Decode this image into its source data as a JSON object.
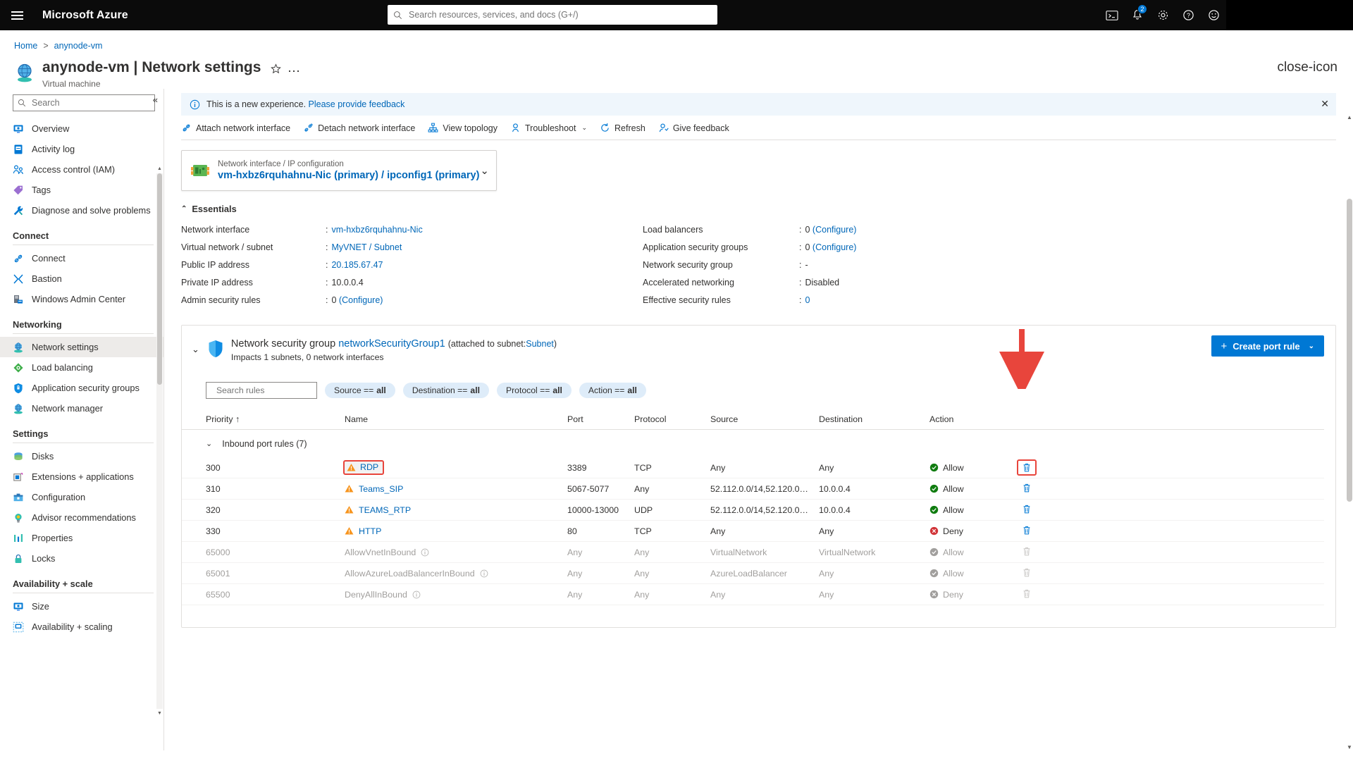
{
  "topbar": {
    "brand": "Microsoft Azure",
    "search_placeholder": "Search resources, services, and docs (G+/)",
    "notification_count": "2",
    "icons": [
      "cloud-shell-icon",
      "notifications-bell-icon",
      "settings-gear-icon",
      "help-question-icon",
      "feedback-smiley-icon"
    ]
  },
  "breadcrumb": {
    "home": "Home",
    "separator": ">",
    "current": "anynode-vm"
  },
  "header": {
    "title": "anynode-vm | Network settings",
    "subtitle": "Virtual machine",
    "favorite_icon": "star-icon",
    "more_icon": "ellipsis-icon",
    "close_icon": "close-icon"
  },
  "sidebar": {
    "search_placeholder": "Search",
    "collapse_label": "«",
    "items": [
      {
        "label": "Overview",
        "icon": "overview-icon",
        "type": "item",
        "selected": false
      },
      {
        "label": "Activity log",
        "icon": "activity-log-icon",
        "type": "item",
        "selected": false
      },
      {
        "label": "Access control (IAM)",
        "icon": "access-control-icon",
        "type": "item",
        "selected": false
      },
      {
        "label": "Tags",
        "icon": "tags-icon",
        "type": "item",
        "selected": false
      },
      {
        "label": "Diagnose and solve problems",
        "icon": "diagnose-icon",
        "type": "item",
        "selected": false
      },
      {
        "label": "Connect",
        "type": "group"
      },
      {
        "label": "Connect",
        "icon": "connect-icon",
        "type": "item",
        "selected": false
      },
      {
        "label": "Bastion",
        "icon": "bastion-icon",
        "type": "item",
        "selected": false
      },
      {
        "label": "Windows Admin Center",
        "icon": "windows-admin-center-icon",
        "type": "item",
        "selected": false
      },
      {
        "label": "Networking",
        "type": "group"
      },
      {
        "label": "Network settings",
        "icon": "network-settings-icon",
        "type": "item",
        "selected": true
      },
      {
        "label": "Load balancing",
        "icon": "load-balancing-icon",
        "type": "item",
        "selected": false
      },
      {
        "label": "Application security groups",
        "icon": "app-security-groups-icon",
        "type": "item",
        "selected": false
      },
      {
        "label": "Network manager",
        "icon": "network-manager-icon",
        "type": "item",
        "selected": false
      },
      {
        "label": "Settings",
        "type": "group"
      },
      {
        "label": "Disks",
        "icon": "disks-icon",
        "type": "item",
        "selected": false
      },
      {
        "label": "Extensions + applications",
        "icon": "extensions-icon",
        "type": "item",
        "selected": false
      },
      {
        "label": "Configuration",
        "icon": "configuration-icon",
        "type": "item",
        "selected": false
      },
      {
        "label": "Advisor recommendations",
        "icon": "advisor-icon",
        "type": "item",
        "selected": false
      },
      {
        "label": "Properties",
        "icon": "properties-icon",
        "type": "item",
        "selected": false
      },
      {
        "label": "Locks",
        "icon": "locks-icon",
        "type": "item",
        "selected": false
      },
      {
        "label": "Availability + scale",
        "type": "group"
      },
      {
        "label": "Size",
        "icon": "size-icon",
        "type": "item",
        "selected": false
      },
      {
        "label": "Availability + scaling",
        "icon": "availability-scaling-icon",
        "type": "item",
        "selected": false
      }
    ]
  },
  "notice": {
    "text": "This is a new experience.",
    "link": "Please provide feedback",
    "icon": "info-circle-icon",
    "dismiss": "✕"
  },
  "toolbar": [
    {
      "label": "Attach network interface",
      "icon": "attach-nic-icon",
      "chevron": false
    },
    {
      "label": "Detach network interface",
      "icon": "detach-nic-icon",
      "chevron": false
    },
    {
      "label": "View topology",
      "icon": "topology-icon",
      "chevron": false
    },
    {
      "label": "Troubleshoot",
      "icon": "troubleshoot-icon",
      "chevron": true
    },
    {
      "label": "Refresh",
      "icon": "refresh-icon",
      "chevron": false
    },
    {
      "label": "Give feedback",
      "icon": "give-feedback-icon",
      "chevron": false
    }
  ],
  "nic_card": {
    "label": "Network interface / IP configuration",
    "value": "vm-hxbz6rquhahnu-Nic (primary) / ipconfig1 (primary)",
    "icon": "nic-icon",
    "chevron": "⌄"
  },
  "essentials": {
    "title": "Essentials",
    "chevron": "⌃",
    "left": [
      {
        "key": "Network interface",
        "value": "vm-hxbz6rquhahnu-Nic",
        "link": true
      },
      {
        "key": "Virtual network / subnet",
        "value": "MyVNET / Subnet",
        "link": true
      },
      {
        "key": "Public IP address",
        "value": "20.185.67.47",
        "link": true
      },
      {
        "key": "Private IP address",
        "value": "10.0.0.4",
        "link": false
      },
      {
        "key": "Admin security rules",
        "value": "0",
        "suffix": "(Configure)",
        "link": false
      }
    ],
    "right": [
      {
        "key": "Load balancers",
        "value": "0",
        "suffix": "(Configure)",
        "link": false
      },
      {
        "key": "Application security groups",
        "value": "0",
        "suffix": "(Configure)",
        "link": false
      },
      {
        "key": "Network security group",
        "value": "-",
        "link": false
      },
      {
        "key": "Accelerated networking",
        "value": "Disabled",
        "link": false
      },
      {
        "key": "Effective security rules",
        "value": "0",
        "link": true
      }
    ]
  },
  "nsg": {
    "chevron": "⌄",
    "shield_icon": "shield-icon",
    "title_prefix": "Network security group",
    "name": "networkSecurityGroup1",
    "attached_text": "(attached to subnet:",
    "subnet_link": "Subnet",
    "attached_close": ")",
    "subtitle": "Impacts 1 subnets, 0 network interfaces",
    "create_button": {
      "label": "Create port rule",
      "plus": "+",
      "chevron": "⌄"
    },
    "search_placeholder": "Search rules",
    "filters": [
      {
        "field": "Source ==",
        "value": "all"
      },
      {
        "field": "Destination ==",
        "value": "all"
      },
      {
        "field": "Protocol ==",
        "value": "all"
      },
      {
        "field": "Action ==",
        "value": "all"
      }
    ],
    "columns": [
      "Priority ↑",
      "Name",
      "Port",
      "Protocol",
      "Source",
      "Destination",
      "Action"
    ],
    "group_label": "Inbound port rules (7)",
    "group_chevron": "⌄",
    "rows": [
      {
        "priority": "300",
        "name": "RDP",
        "port": "3389",
        "protocol": "TCP",
        "source": "Any",
        "destination": "Any",
        "action": "Allow",
        "warn": true,
        "info": false,
        "dim": false,
        "highlight": true,
        "delete_highlight": true
      },
      {
        "priority": "310",
        "name": "Teams_SIP",
        "port": "5067-5077",
        "protocol": "Any",
        "source": "52.112.0.0/14,52.120.0…",
        "destination": "10.0.0.4",
        "action": "Allow",
        "warn": true,
        "info": false,
        "dim": false,
        "highlight": false,
        "delete_highlight": false
      },
      {
        "priority": "320",
        "name": "TEAMS_RTP",
        "port": "10000-13000",
        "protocol": "UDP",
        "source": "52.112.0.0/14,52.120.0…",
        "destination": "10.0.0.4",
        "action": "Allow",
        "warn": true,
        "info": false,
        "dim": false,
        "highlight": false,
        "delete_highlight": false
      },
      {
        "priority": "330",
        "name": "HTTP",
        "port": "80",
        "protocol": "TCP",
        "source": "Any",
        "destination": "Any",
        "action": "Deny",
        "warn": true,
        "info": false,
        "dim": false,
        "highlight": false,
        "delete_highlight": false
      },
      {
        "priority": "65000",
        "name": "AllowVnetInBound",
        "port": "Any",
        "protocol": "Any",
        "source": "VirtualNetwork",
        "destination": "VirtualNetwork",
        "action": "Allow",
        "warn": false,
        "info": true,
        "dim": true,
        "highlight": false,
        "delete_highlight": false
      },
      {
        "priority": "65001",
        "name": "AllowAzureLoadBalancerInBound",
        "port": "Any",
        "protocol": "Any",
        "source": "AzureLoadBalancer",
        "destination": "Any",
        "action": "Allow",
        "warn": false,
        "info": true,
        "dim": true,
        "highlight": false,
        "delete_highlight": false
      },
      {
        "priority": "65500",
        "name": "DenyAllInBound",
        "port": "Any",
        "protocol": "Any",
        "source": "Any",
        "destination": "Any",
        "action": "Deny",
        "warn": false,
        "info": true,
        "dim": true,
        "highlight": false,
        "delete_highlight": false
      }
    ]
  },
  "colors": {
    "accent": "#0078d4",
    "link": "#0067b8",
    "allow": "#107c10",
    "deny": "#d13438",
    "warning": "#f7941d",
    "annotation": "#e8453c",
    "topbar_bg": "#0b0b0b",
    "info_bg": "#eff6fc"
  }
}
